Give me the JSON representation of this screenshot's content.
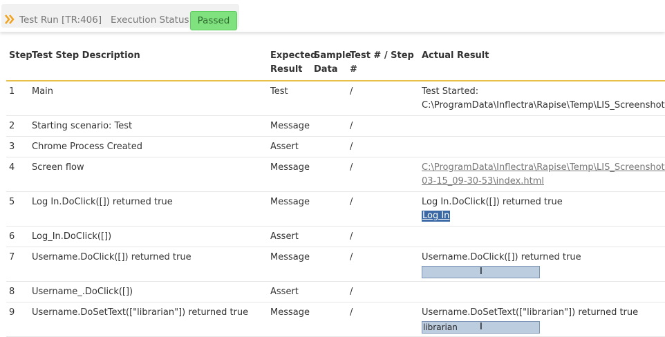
{
  "header": {
    "run_label": "Test Run [TR:406]",
    "status_label": "Execution Status:",
    "status_value": "Passed",
    "status_color": "#7fe27f"
  },
  "table": {
    "columns": [
      "Step",
      "Test Step Description",
      "Expected Result",
      "Sample Data",
      "Test # / Step #",
      "Actual Result"
    ],
    "column_lines": {
      "expected": [
        "Expected",
        "Result"
      ],
      "sample": [
        "Sample",
        "Data"
      ]
    },
    "rows": [
      {
        "step": "1",
        "description": "Main",
        "expected": "Test",
        "sample": "",
        "test_step": "/",
        "actual": [
          "Test Started:",
          "C:\\ProgramData\\Inflectra\\Rapise\\Temp\\LIS_Screenshots\\"
        ]
      },
      {
        "step": "2",
        "description": "Starting scenario: Test",
        "expected": "Message",
        "sample": "",
        "test_step": "/",
        "actual": [
          ""
        ]
      },
      {
        "step": "3",
        "description": "Chrome Process Created",
        "expected": "Assert",
        "sample": "",
        "test_step": "/",
        "actual": [
          ""
        ]
      },
      {
        "step": "4",
        "description": "Screen flow",
        "expected": "Message",
        "sample": "",
        "test_step": "/",
        "actual_link": [
          "C:\\ProgramData\\Inflectra\\Rapise\\Temp\\LIS_Screenshots\\",
          "03-15_09-30-53\\index.html"
        ]
      },
      {
        "step": "5",
        "description": "Log In.DoClick([]) returned true",
        "expected": "Message",
        "sample": "",
        "test_step": "/",
        "actual": [
          "Log In.DoClick([]) returned true"
        ],
        "thumb": "Log In"
      },
      {
        "step": "6",
        "description": "Log_In.DoClick([])",
        "expected": "Assert",
        "sample": "",
        "test_step": "/",
        "actual": [
          ""
        ]
      },
      {
        "step": "7",
        "description": "Username.DoClick([]) returned true",
        "expected": "Message",
        "sample": "",
        "test_step": "/",
        "actual": [
          "Username.DoClick([]) returned true"
        ],
        "field": ""
      },
      {
        "step": "8",
        "description": "Username_.DoClick([])",
        "expected": "Assert",
        "sample": "",
        "test_step": "/",
        "actual": [
          ""
        ]
      },
      {
        "step": "9",
        "description": "Username.DoSetText([\"librarian\"]) returned true",
        "expected": "Message",
        "sample": "",
        "test_step": "/",
        "actual": [
          "Username.DoSetText([\"librarian\"]) returned true"
        ],
        "field": "librarian"
      }
    ]
  }
}
